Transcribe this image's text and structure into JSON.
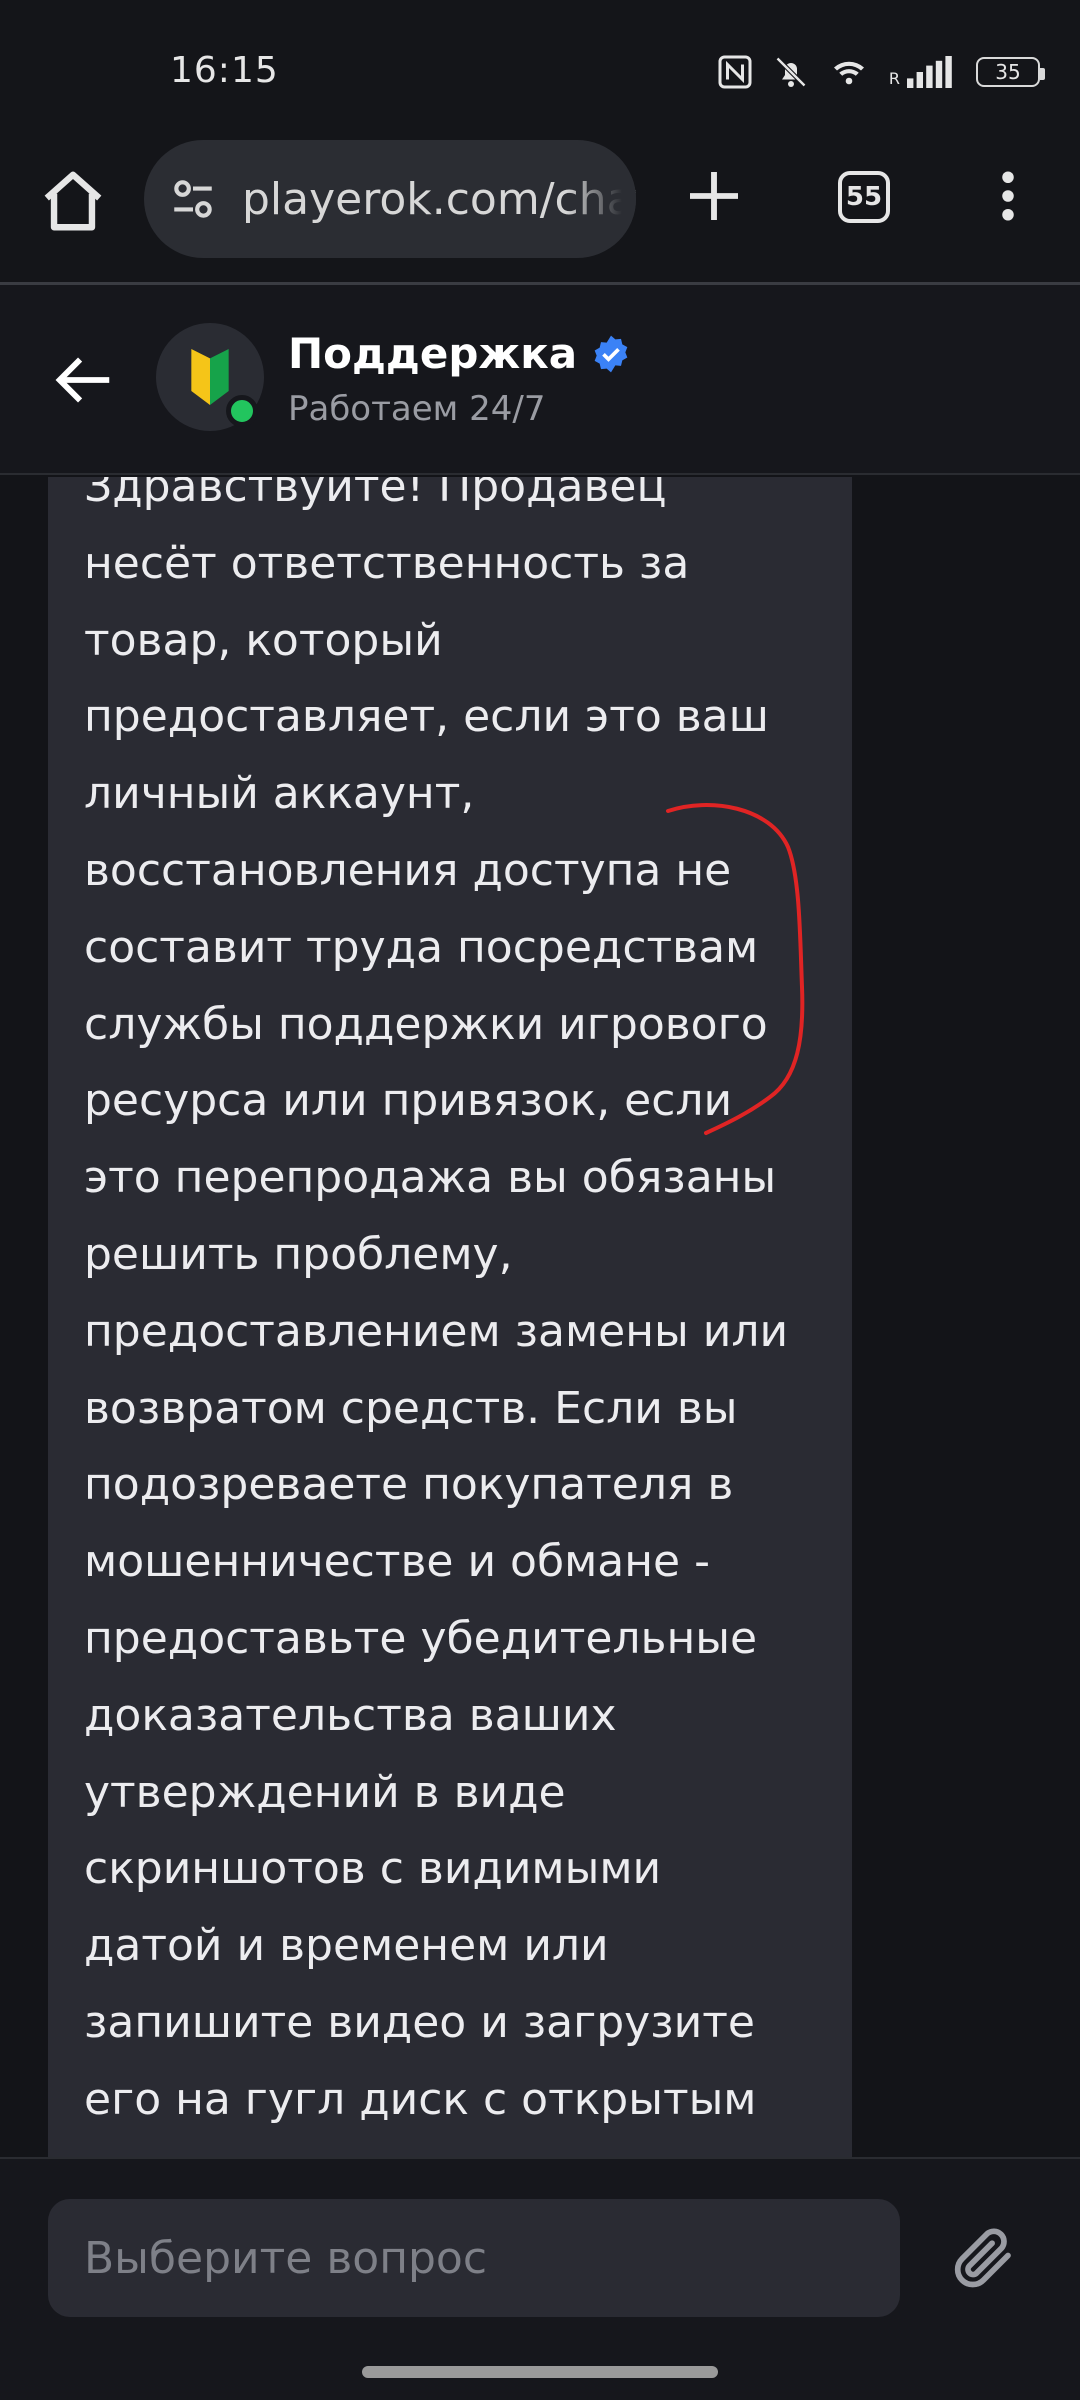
{
  "status_bar": {
    "time": "16:15",
    "network_label": "R",
    "battery": "35"
  },
  "browser": {
    "url": "playerok.com/chats",
    "tab_count": "55"
  },
  "chat": {
    "title": "Поддержка",
    "subtitle": "Работаем 24/7"
  },
  "message": {
    "lines": [
      "Здравствуйте! Продавец",
      "несёт ответственность за",
      "товар, который",
      "предоставляет, если это ваш",
      "личный аккаунт,",
      "восстановления доступа не",
      "составит труда посредствам",
      "службы поддержки игрового",
      "ресурса или привязок, если",
      "это перепродажа вы обязаны",
      "решить проблему,",
      "предоставлением замены или",
      "возвратом средств. Если вы",
      "подозреваете покупателя в",
      "мошенничестве и обмане -",
      "предоставьте убедительные",
      "доказательства ваших",
      "утверждений в виде",
      "скриншотов с видимыми",
      "датой и временем или",
      "запишите видео и загрузите",
      "его на гугл диск с открытым"
    ]
  },
  "input": {
    "placeholder": "Выберите вопрос"
  },
  "colors": {
    "annotation": "#e02424",
    "online": "#22c55e",
    "verified": "#3b82f6"
  }
}
